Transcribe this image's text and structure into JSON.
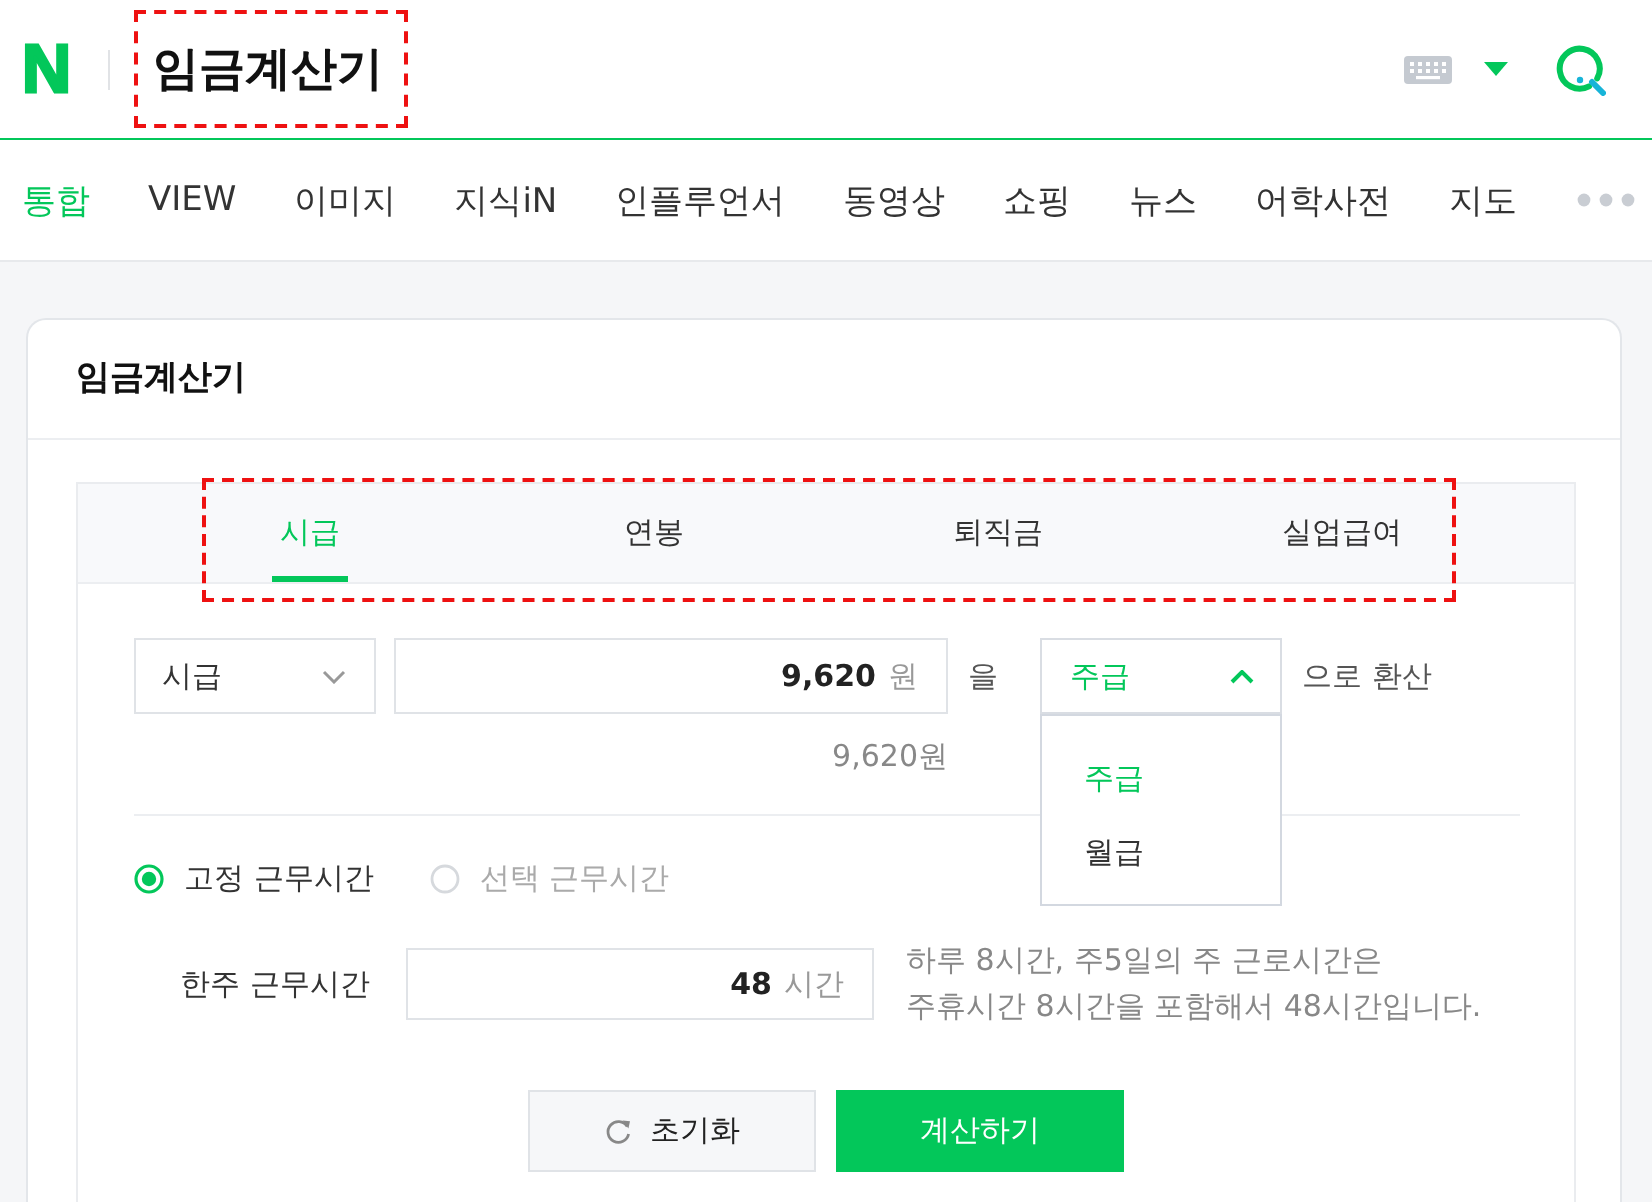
{
  "header": {
    "logo": "N",
    "query": "임금계산기",
    "highlighted": true
  },
  "nav": [
    {
      "label": "통합",
      "selected": true
    },
    {
      "label": "VIEW",
      "selected": false
    },
    {
      "label": "이미지",
      "selected": false
    },
    {
      "label": "지식iN",
      "selected": false
    },
    {
      "label": "인플루언서",
      "selected": false
    },
    {
      "label": "동영상",
      "selected": false
    },
    {
      "label": "쇼핑",
      "selected": false
    },
    {
      "label": "뉴스",
      "selected": false
    },
    {
      "label": "어학사전",
      "selected": false
    },
    {
      "label": "지도",
      "selected": false
    }
  ],
  "calculator": {
    "title": "임금계산기",
    "tabs_highlighted": true,
    "tabs": [
      {
        "label": "시급",
        "selected": true
      },
      {
        "label": "연봉",
        "selected": false
      },
      {
        "label": "퇴직금",
        "selected": false
      },
      {
        "label": "실업급여",
        "selected": false
      }
    ],
    "from_unit": {
      "value": "시급"
    },
    "amount": {
      "value": "9,620",
      "unit": "원"
    },
    "particle": "을",
    "to_unit": {
      "value": "주급",
      "expanded": true,
      "options": [
        {
          "label": "주급",
          "selected": true
        },
        {
          "label": "월급",
          "selected": false
        }
      ]
    },
    "suffix": "으로 환산",
    "converted": "9,620원",
    "work_types": [
      {
        "label": "고정 근무시간",
        "selected": true
      },
      {
        "label": "선택 근무시간",
        "selected": false
      }
    ],
    "hours": {
      "label": "한주 근무시간",
      "value": "48",
      "unit": "시간"
    },
    "note": "하루 8시간, 주5일의 주 근로시간은\n주휴시간 8시간을 포함해서 48시간입니다.",
    "buttons": [
      {
        "kind": "reset",
        "label": "초기화"
      },
      {
        "kind": "primary",
        "label": "계산하기"
      }
    ]
  }
}
